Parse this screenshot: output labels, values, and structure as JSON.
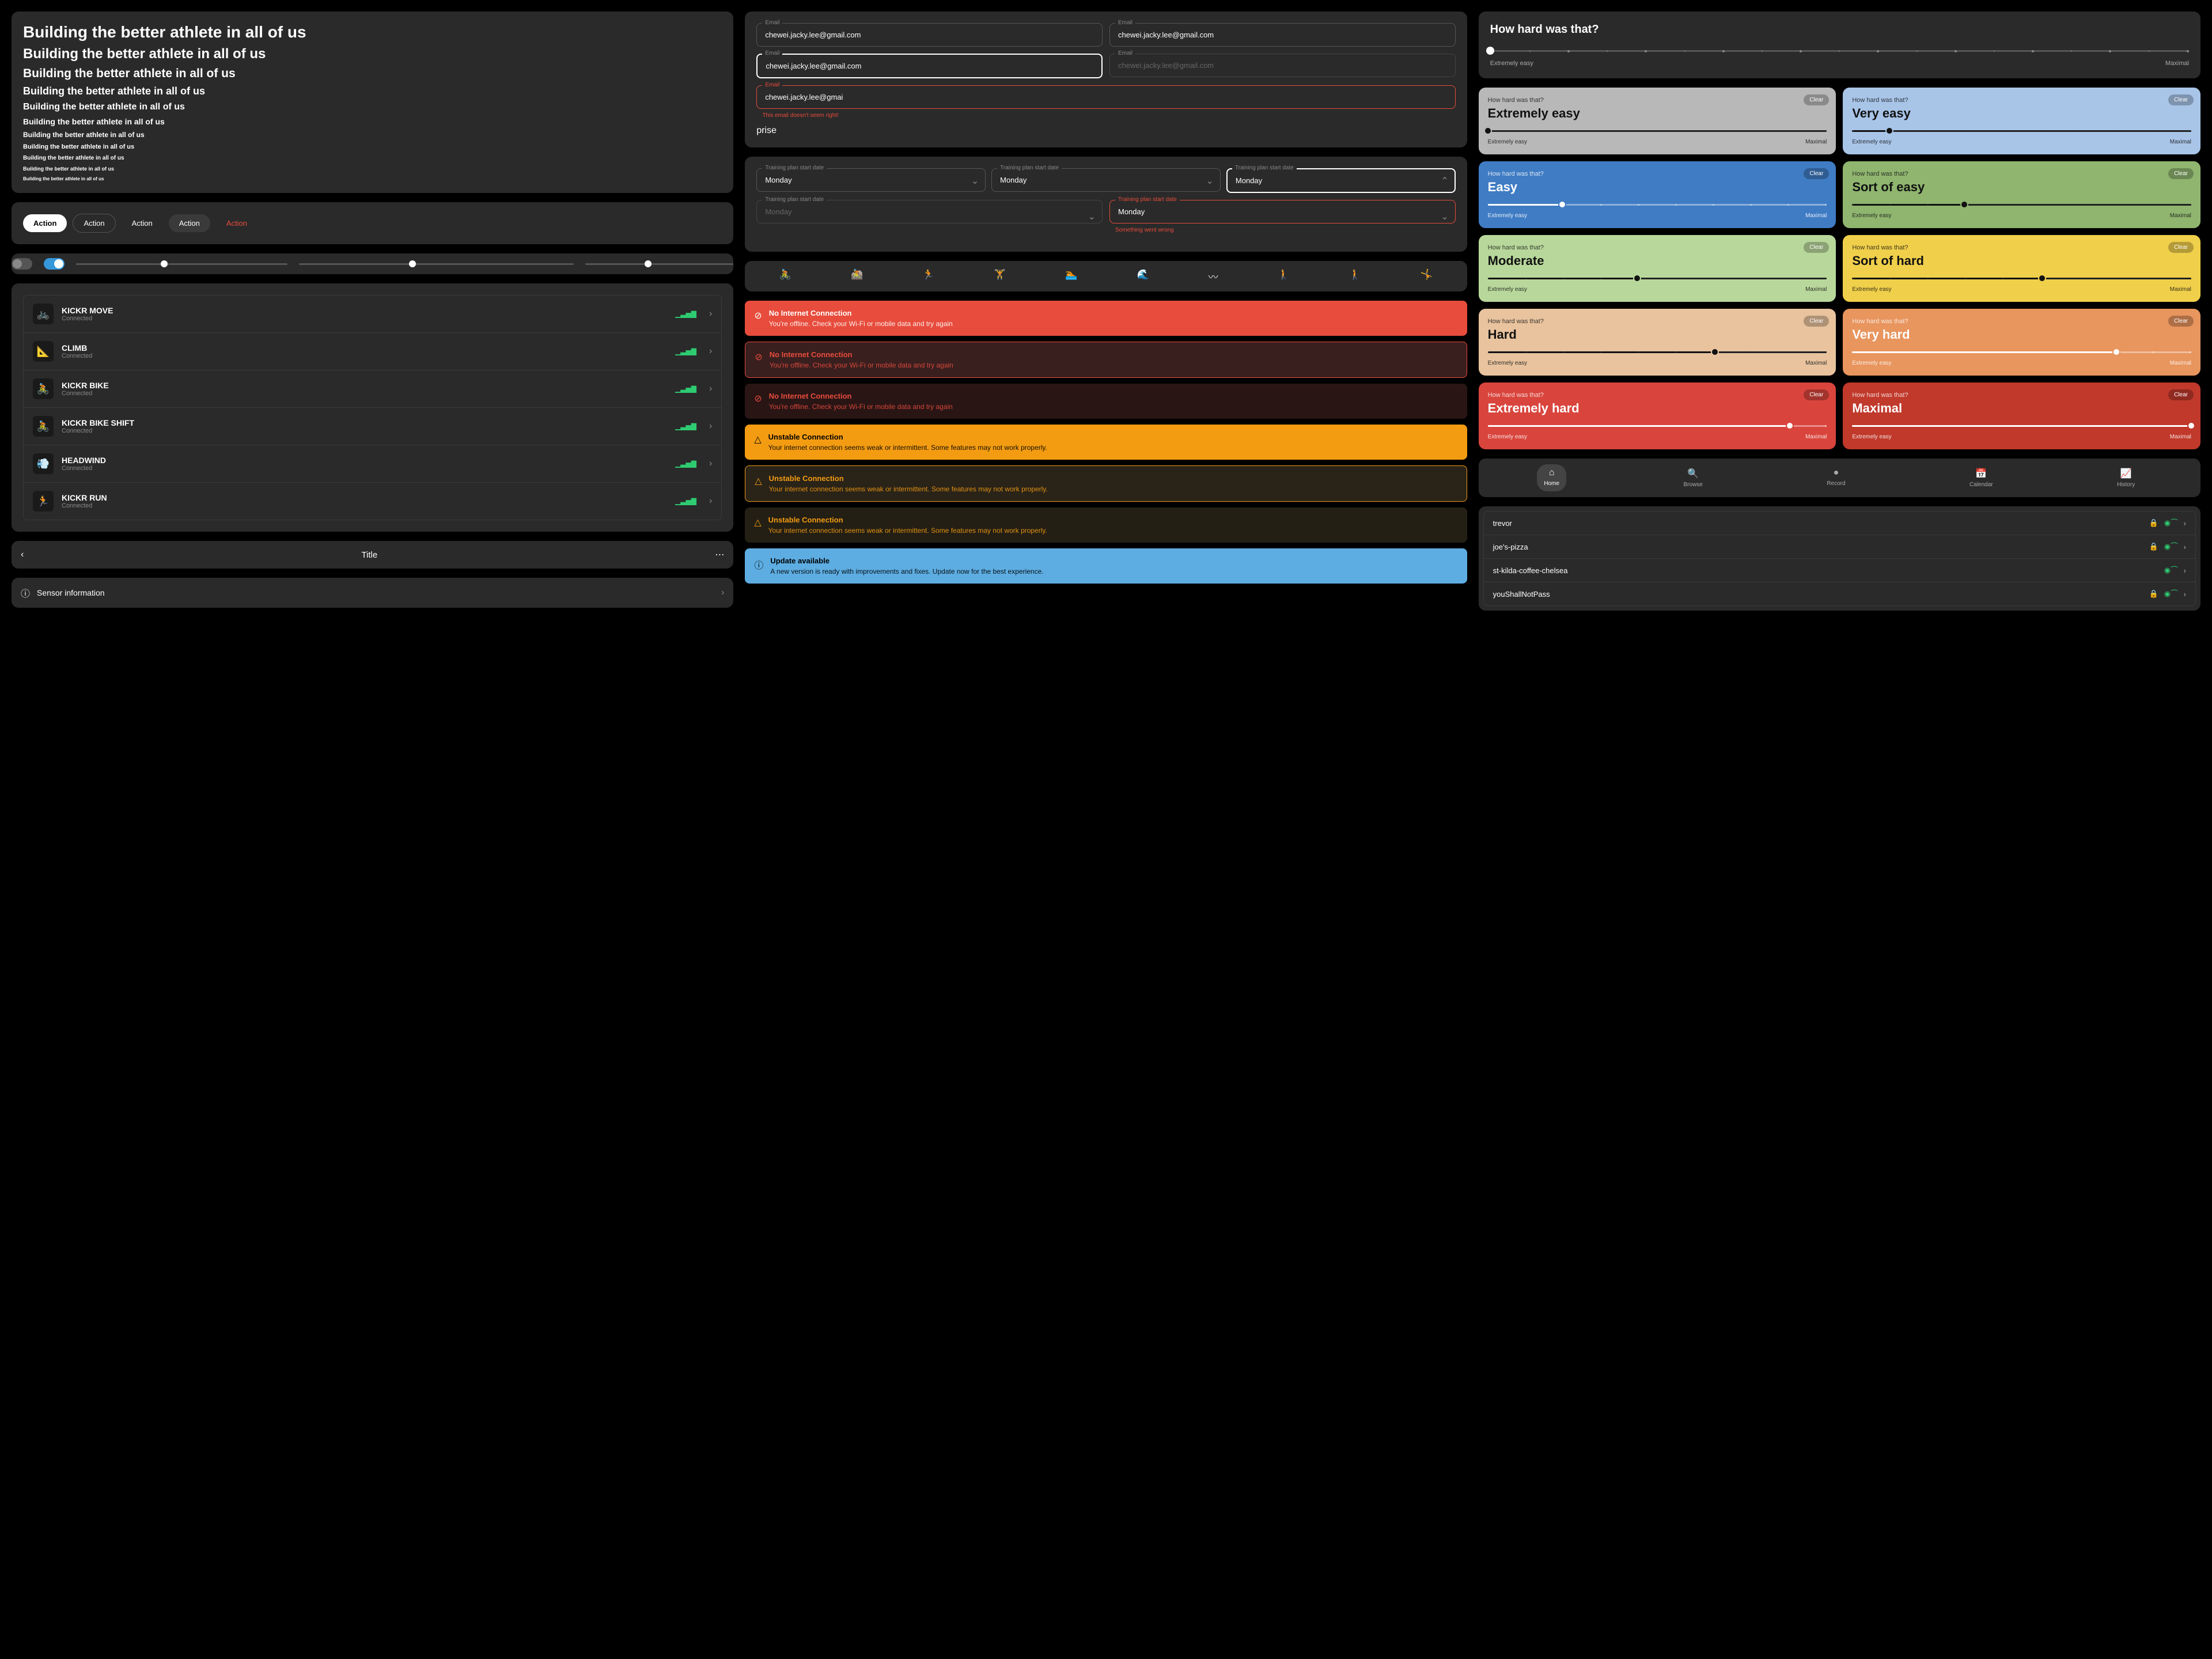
{
  "typography": {
    "text": "Building the better athlete in all of us"
  },
  "buttons": {
    "label": "Action"
  },
  "devices": {
    "items": [
      {
        "name": "KICKR MOVE",
        "status": "Connected",
        "glyph": "🚲"
      },
      {
        "name": "CLIMB",
        "status": "Connected",
        "glyph": "📐"
      },
      {
        "name": "KICKR BIKE",
        "status": "Connected",
        "glyph": "🚴"
      },
      {
        "name": "KICKR BIKE SHIFT",
        "status": "Connected",
        "glyph": "🚴"
      },
      {
        "name": "HEADWIND",
        "status": "Connected",
        "glyph": "💨"
      },
      {
        "name": "KICKR RUN",
        "status": "Connected",
        "glyph": "🏃"
      }
    ]
  },
  "navbar": {
    "title": "Title"
  },
  "sensor": {
    "label": "Sensor information"
  },
  "inputs": {
    "email_label": "Email",
    "email_value": "chewei.jacky.lee@gmail.com",
    "email_error_value": "chewei.jacky.lee@gmai",
    "email_error_msg": "This email doesn't seem right!",
    "plan_label": "Training plan start date",
    "plan_value": "Monday",
    "plan_error_msg": "Something went wrong"
  },
  "activity_icons": [
    "🚴",
    "🚵",
    "🏃",
    "🏋️",
    "🏊",
    "🌊",
    "〰",
    "🚶",
    "🚶",
    "🤸"
  ],
  "alerts": {
    "offline_title": "No Internet Connection",
    "offline_body": "You're offline. Check your Wi-Fi or mobile data and try again",
    "unstable_title": "Unstable Connection",
    "unstable_body": "Your internet connection seems weak or intermittent. Some features may not work properly.",
    "update_title": "Update available",
    "update_body": "A new version is ready with improvements and fixes. Update now for the best experience."
  },
  "rpe": {
    "question": "How hard was that?",
    "clear": "Clear",
    "min_label": "Extremely easy",
    "max_label": "Maximal",
    "levels": [
      {
        "label": "Extremely easy",
        "bg": "#b8b8b8",
        "fg": "#111",
        "pos": 0
      },
      {
        "label": "Very easy",
        "bg": "#a8c5e8",
        "fg": "#111",
        "pos": 11
      },
      {
        "label": "Easy",
        "bg": "#3f7cc4",
        "fg": "#fff",
        "pos": 22
      },
      {
        "label": "Sort of easy",
        "bg": "#8fb56f",
        "fg": "#111",
        "pos": 33
      },
      {
        "label": "Moderate",
        "bg": "#b8d89b",
        "fg": "#111",
        "pos": 44
      },
      {
        "label": "Sort of hard",
        "bg": "#f0cf4a",
        "fg": "#111",
        "pos": 56
      },
      {
        "label": "Hard",
        "bg": "#e8c39e",
        "fg": "#111",
        "pos": 67
      },
      {
        "label": "Very hard",
        "bg": "#e8955e",
        "fg": "#fff",
        "pos": 78
      },
      {
        "label": "Extremely hard",
        "bg": "#d9453d",
        "fg": "#fff",
        "pos": 89
      },
      {
        "label": "Maximal",
        "bg": "#c0392b",
        "fg": "#fff",
        "pos": 100
      }
    ]
  },
  "tabs": [
    {
      "label": "Home",
      "icon": "⌂"
    },
    {
      "label": "Browse",
      "icon": "🔍"
    },
    {
      "label": "Record",
      "icon": "●"
    },
    {
      "label": "Calendar",
      "icon": "📅"
    },
    {
      "label": "History",
      "icon": "📈"
    }
  ],
  "wifi": [
    {
      "name": "trevor",
      "locked": true
    },
    {
      "name": "joe's-pizza",
      "locked": true
    },
    {
      "name": "st-kilda-coffee-chelsea",
      "locked": false
    },
    {
      "name": "youShallNotPass",
      "locked": true
    }
  ]
}
